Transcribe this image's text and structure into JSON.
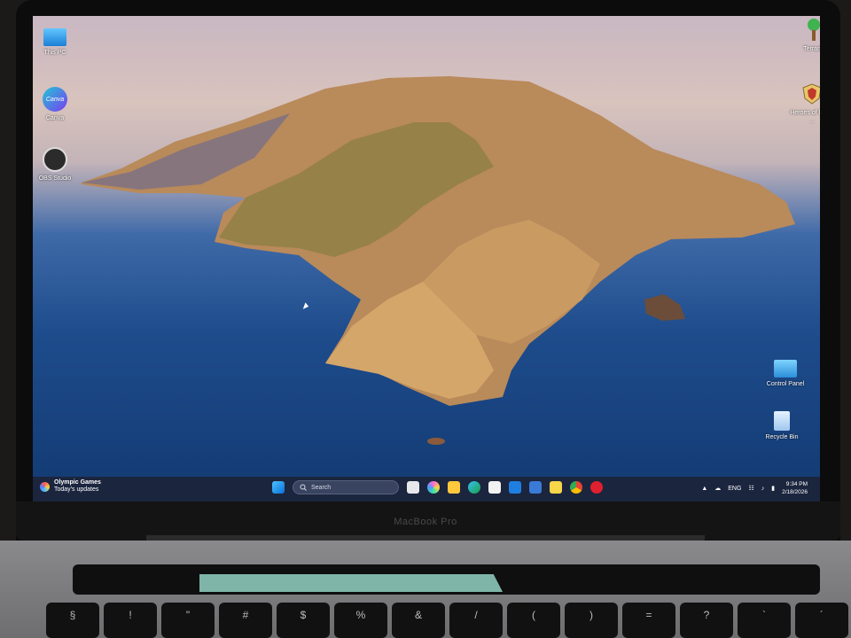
{
  "device": {
    "brand_label": "MacBook Pro"
  },
  "desktop": {
    "icons_left": [
      {
        "label": "This PC",
        "icon": "monitor-icon"
      },
      {
        "label": "Canva",
        "icon": "canva-icon"
      },
      {
        "label": "OBS Studio",
        "icon": "obs-icon"
      }
    ],
    "icons_right": [
      {
        "label": "Terraria",
        "icon": "tree-icon"
      },
      {
        "label": "Heroes of Might ...",
        "icon": "shield-crest-icon"
      },
      {
        "label": "Control Panel",
        "icon": "control-panel-icon"
      },
      {
        "label": "Recycle Bin",
        "icon": "recycle-bin-icon"
      }
    ]
  },
  "taskbar": {
    "widget": {
      "title": "Olympic Games",
      "subtitle": "Today's updates"
    },
    "search_placeholder": "Search",
    "pinned": [
      "windows-start-icon",
      "search-field",
      "task-view-icon",
      "copilot-icon",
      "file-explorer-icon",
      "edge-icon",
      "store-icon",
      "mail-icon",
      "widgets-icon",
      "sticky-notes-icon",
      "chrome-icon",
      "opera-icon"
    ],
    "tray": {
      "language": "ENG",
      "time": "9:34 PM",
      "date": "2/18/2026"
    }
  },
  "keyboard": {
    "keys": [
      "§",
      "!",
      "\"",
      "#",
      "$",
      "%",
      "&",
      "/",
      "(",
      ")",
      "=",
      "?",
      "`",
      "´"
    ]
  },
  "colors": {
    "taskbar": "#1c243a",
    "sea": "#1e4c8c",
    "sky": "#d8c3bd",
    "accent": "#0a84ff"
  }
}
